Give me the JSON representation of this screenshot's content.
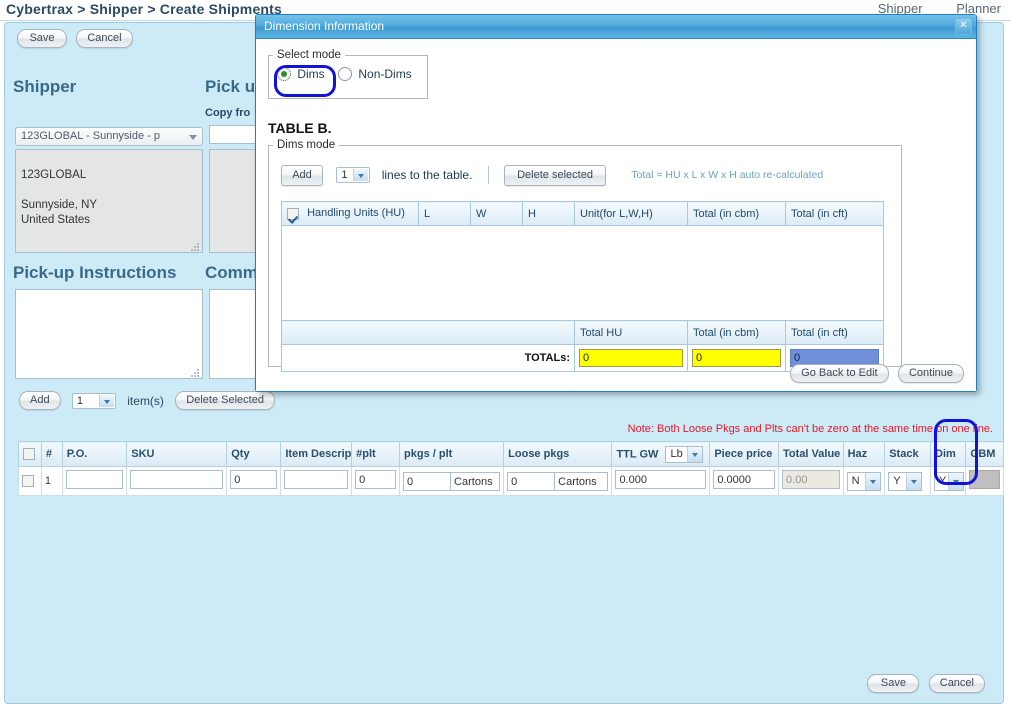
{
  "breadcrumb": "Cybertrax > Shipper > Create Shipments",
  "top_tabs": [
    {
      "label": "Shipper"
    },
    {
      "label": "Planner"
    }
  ],
  "top_actions": {
    "save_label": "Save",
    "cancel_label": "Cancel"
  },
  "bottom_actions": {
    "save_label": "Save",
    "cancel_label": "Cancel"
  },
  "left_form": {
    "shipper_heading": "Shipper",
    "shipper_select_value": "123GLOBAL - Sunnyside - p",
    "shipper_address": "123GLOBAL\n\nSunnyside, NY\nUnited States",
    "pickup_instructions_heading": "Pick-up Instructions",
    "pickup_instructions_value": ""
  },
  "middle_form": {
    "pickup_heading": "Pick up",
    "copy_from_label": "Copy fro",
    "copy_from_value": "",
    "comments_heading": "Comme",
    "comments_value": ""
  },
  "items_toolbar": {
    "add_label": "Add",
    "count_value": "1",
    "items_label": "item(s)",
    "delete_label": "Delete Selected"
  },
  "note": "Note: Both Loose Pkgs and Plts can't be zero at the same time on one line.",
  "item_grid": {
    "columns": [
      "",
      "#",
      "P.O.",
      "SKU",
      "Qty",
      "Item Descrip",
      "#plt",
      "pkgs / plt",
      "Loose pkgs",
      "TTL GW",
      "Piece price",
      "Total Value",
      "Haz",
      "Stack",
      "Dim",
      "CBM"
    ],
    "ttl_gw_unit": "Lb",
    "rows": [
      {
        "selected": false,
        "num": "1",
        "po": "",
        "sku": "",
        "qty": "0",
        "item_description": "",
        "plt": "0",
        "pkgs_per_plt_qty": "0",
        "pkgs_per_plt_unit": "Cartons",
        "loose_pkgs_qty": "0",
        "loose_pkgs_unit": "Cartons",
        "ttl_gw": "0.000",
        "piece_price": "0.0000",
        "total_value": "0.00",
        "haz": "N",
        "stack": "Y",
        "dim": "Y",
        "cbm": ""
      }
    ]
  },
  "modal": {
    "title": "Dimension Information",
    "close_label": "✕",
    "select_mode": {
      "legend": "Select mode",
      "options": [
        {
          "label": "Dims",
          "selected": true
        },
        {
          "label": "Non-Dims",
          "selected": false
        }
      ]
    },
    "table_b_label": "TABLE B.",
    "dims_mode": {
      "legend": "Dims mode",
      "add_label": "Add",
      "lines_count": "1",
      "lines_label": "lines to the table.",
      "delete_label": "Delete selected",
      "formula_hint": "Total = HU x L x W x H auto re-calculated",
      "columns": [
        "Handling Units (HU)",
        "L",
        "W",
        "H",
        "Unit(for L,W,H)",
        "Total (in cbm)",
        "Total (in cft)"
      ],
      "header_checkbox_checked": true,
      "rows": [],
      "totals_headers": [
        "Total HU",
        "Total (in cbm)",
        "Total (in cft)"
      ],
      "totals_word": "TOTALs:",
      "totals_values": [
        "0",
        "0",
        "0"
      ]
    },
    "footer": {
      "go_back_label": "Go Back to Edit",
      "continue_label": "Continue"
    }
  },
  "colors": {
    "panel_bg": "#cdeaf7",
    "modal_title_bg": "#4fa9db",
    "note_red": "#e01b2a",
    "highlight_yellow": "#ffff00",
    "highlight_blue": "#6f8fd8",
    "annotation_blue": "#1212d8"
  }
}
